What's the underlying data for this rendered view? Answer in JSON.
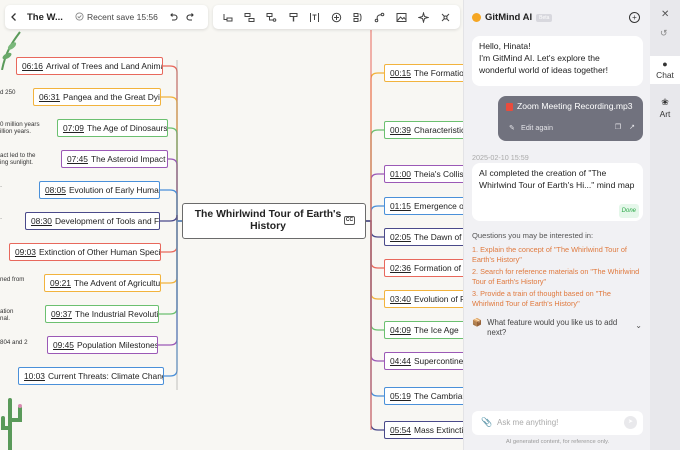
{
  "toolbar": {
    "file_title": "The W...",
    "save_status": "Recent save 15:56",
    "icons": [
      "back-icon",
      "check-circle-icon",
      "undo-icon",
      "redo-icon",
      "insert-child-icon",
      "insert-sibling-icon",
      "insert-parent-icon",
      "format-painter-icon",
      "text-box-icon",
      "add-topic-icon",
      "summary-icon",
      "relationship-icon",
      "picture-icon",
      "ai-icon",
      "more-icon"
    ]
  },
  "mindmap": {
    "root": "The Whirlwind Tour of Earth's History",
    "left": [
      {
        "ts": "06:16",
        "label": "Arrival of Trees and Land Animals",
        "color": "#e8685c"
      },
      {
        "ts": "06:31",
        "label": "Pangea and the Great Dying",
        "color": "#f2b33d"
      },
      {
        "ts": "07:09",
        "label": "The Age of Dinosaurs",
        "color": "#6cc070"
      },
      {
        "ts": "07:45",
        "label": "The Asteroid Impact",
        "color": "#9b59b6"
      },
      {
        "ts": "08:05",
        "label": "Evolution of Early Humans",
        "color": "#4a90d9"
      },
      {
        "ts": "08:30",
        "label": "Development of Tools and Fire",
        "color": "#4a4a8a"
      },
      {
        "ts": "09:03",
        "label": "Extinction of Other Human Species",
        "color": "#e8685c"
      },
      {
        "ts": "09:21",
        "label": "The Advent of Agriculture",
        "color": "#f2b33d"
      },
      {
        "ts": "09:37",
        "label": "The Industrial Revolution",
        "color": "#6cc070"
      },
      {
        "ts": "09:45",
        "label": "Population Milestones",
        "color": "#9b59b6"
      },
      {
        "ts": "10:03",
        "label": "Current Threats: Climate Change",
        "color": "#4a90d9"
      }
    ],
    "right": [
      {
        "ts": "00:15",
        "label": "The Formation",
        "color": "#f2b33d"
      },
      {
        "ts": "00:39",
        "label": "Characteristics",
        "color": "#6cc070"
      },
      {
        "ts": "01:00",
        "label": "Theia's Collision",
        "color": "#9b59b6"
      },
      {
        "ts": "01:15",
        "label": "Emergence of V",
        "color": "#4a90d9"
      },
      {
        "ts": "02:05",
        "label": "The Dawn of Li",
        "color": "#4a4a8a"
      },
      {
        "ts": "02:36",
        "label": "Formation of C",
        "color": "#e8685c"
      },
      {
        "ts": "03:40",
        "label": "Evolution of Ph",
        "color": "#f2b33d"
      },
      {
        "ts": "04:09",
        "label": "The Ice Age",
        "color": "#6cc070"
      },
      {
        "ts": "04:44",
        "label": "Supercontinent",
        "color": "#9b59b6"
      },
      {
        "ts": "05:19",
        "label": "The Cambrian E",
        "color": "#4a90d9"
      },
      {
        "ts": "05:54",
        "label": "Mass Extinction",
        "color": "#4a4a8a"
      }
    ],
    "fragments": [
      "d 250",
      "0 million years",
      "illion years.",
      "act led to the",
      "ing sunlight.",
      "·",
      "·",
      "ned from",
      "ation",
      "nal.",
      "804 and 2"
    ]
  },
  "ai_panel": {
    "brand": "GitMind AI",
    "badge": "Beta",
    "greeting": "Hello, Hinata!\nI'm GitMind AI. Let's explore the wonderful world of ideas together!",
    "file_name": "Zoom Meeting Recording.mp3",
    "edit_again": "Edit again",
    "timestamp": "2025-02-10 15:59",
    "completion": "AI completed the creation of \"The Whirlwind Tour of Earth's Hi...\" mind map",
    "done": "Done",
    "questions_title": "Questions you may be interested in:",
    "suggestions": [
      "1. Explain the concept of \"The Whirlwind Tour of Earth's History\"",
      "2. Search for reference materials on \"The Whirlwind Tour of Earth's History\"",
      "3. Provide a train of thought based on \"The Whirlwind Tour of Earth's History\""
    ],
    "feature_question": "What feature would you like us to add next?",
    "ask_placeholder": "Ask me anything!",
    "disclaimer": "AI generated content, for reference only."
  },
  "side_strip": {
    "chat": "Chat",
    "art": "Art"
  }
}
